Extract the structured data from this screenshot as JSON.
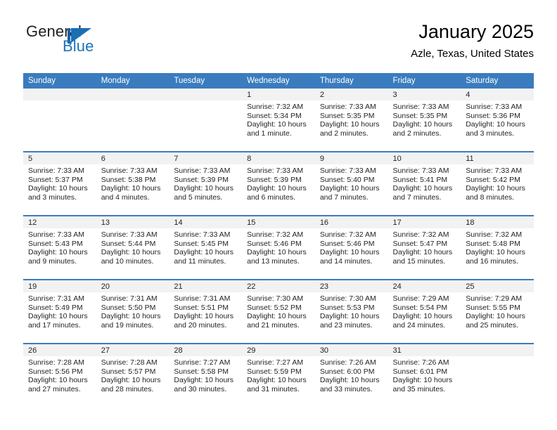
{
  "brand": {
    "name_top": "General",
    "name_bottom": "Blue",
    "mark": "triangle-flag-icon",
    "accent_color": "#1a75bc"
  },
  "header": {
    "month_title": "January 2025",
    "location": "Azle, Texas, United States"
  },
  "theme": {
    "header_row_bg": "#3a7cbe",
    "day_strip_bg": "#f2f2f2",
    "separator_color": "#3a7cbe",
    "text_color": "#231f20"
  },
  "weekday_headers": [
    "Sunday",
    "Monday",
    "Tuesday",
    "Wednesday",
    "Thursday",
    "Friday",
    "Saturday"
  ],
  "weeks": [
    [
      {
        "day": "",
        "sunrise": "",
        "sunset": "",
        "daylight_1": "",
        "daylight_2": ""
      },
      {
        "day": "",
        "sunrise": "",
        "sunset": "",
        "daylight_1": "",
        "daylight_2": ""
      },
      {
        "day": "",
        "sunrise": "",
        "sunset": "",
        "daylight_1": "",
        "daylight_2": ""
      },
      {
        "day": "1",
        "sunrise": "Sunrise: 7:32 AM",
        "sunset": "Sunset: 5:34 PM",
        "daylight_1": "Daylight: 10 hours",
        "daylight_2": "and 1 minute."
      },
      {
        "day": "2",
        "sunrise": "Sunrise: 7:33 AM",
        "sunset": "Sunset: 5:35 PM",
        "daylight_1": "Daylight: 10 hours",
        "daylight_2": "and 2 minutes."
      },
      {
        "day": "3",
        "sunrise": "Sunrise: 7:33 AM",
        "sunset": "Sunset: 5:35 PM",
        "daylight_1": "Daylight: 10 hours",
        "daylight_2": "and 2 minutes."
      },
      {
        "day": "4",
        "sunrise": "Sunrise: 7:33 AM",
        "sunset": "Sunset: 5:36 PM",
        "daylight_1": "Daylight: 10 hours",
        "daylight_2": "and 3 minutes."
      }
    ],
    [
      {
        "day": "5",
        "sunrise": "Sunrise: 7:33 AM",
        "sunset": "Sunset: 5:37 PM",
        "daylight_1": "Daylight: 10 hours",
        "daylight_2": "and 3 minutes."
      },
      {
        "day": "6",
        "sunrise": "Sunrise: 7:33 AM",
        "sunset": "Sunset: 5:38 PM",
        "daylight_1": "Daylight: 10 hours",
        "daylight_2": "and 4 minutes."
      },
      {
        "day": "7",
        "sunrise": "Sunrise: 7:33 AM",
        "sunset": "Sunset: 5:39 PM",
        "daylight_1": "Daylight: 10 hours",
        "daylight_2": "and 5 minutes."
      },
      {
        "day": "8",
        "sunrise": "Sunrise: 7:33 AM",
        "sunset": "Sunset: 5:39 PM",
        "daylight_1": "Daylight: 10 hours",
        "daylight_2": "and 6 minutes."
      },
      {
        "day": "9",
        "sunrise": "Sunrise: 7:33 AM",
        "sunset": "Sunset: 5:40 PM",
        "daylight_1": "Daylight: 10 hours",
        "daylight_2": "and 7 minutes."
      },
      {
        "day": "10",
        "sunrise": "Sunrise: 7:33 AM",
        "sunset": "Sunset: 5:41 PM",
        "daylight_1": "Daylight: 10 hours",
        "daylight_2": "and 7 minutes."
      },
      {
        "day": "11",
        "sunrise": "Sunrise: 7:33 AM",
        "sunset": "Sunset: 5:42 PM",
        "daylight_1": "Daylight: 10 hours",
        "daylight_2": "and 8 minutes."
      }
    ],
    [
      {
        "day": "12",
        "sunrise": "Sunrise: 7:33 AM",
        "sunset": "Sunset: 5:43 PM",
        "daylight_1": "Daylight: 10 hours",
        "daylight_2": "and 9 minutes."
      },
      {
        "day": "13",
        "sunrise": "Sunrise: 7:33 AM",
        "sunset": "Sunset: 5:44 PM",
        "daylight_1": "Daylight: 10 hours",
        "daylight_2": "and 10 minutes."
      },
      {
        "day": "14",
        "sunrise": "Sunrise: 7:33 AM",
        "sunset": "Sunset: 5:45 PM",
        "daylight_1": "Daylight: 10 hours",
        "daylight_2": "and 11 minutes."
      },
      {
        "day": "15",
        "sunrise": "Sunrise: 7:32 AM",
        "sunset": "Sunset: 5:46 PM",
        "daylight_1": "Daylight: 10 hours",
        "daylight_2": "and 13 minutes."
      },
      {
        "day": "16",
        "sunrise": "Sunrise: 7:32 AM",
        "sunset": "Sunset: 5:46 PM",
        "daylight_1": "Daylight: 10 hours",
        "daylight_2": "and 14 minutes."
      },
      {
        "day": "17",
        "sunrise": "Sunrise: 7:32 AM",
        "sunset": "Sunset: 5:47 PM",
        "daylight_1": "Daylight: 10 hours",
        "daylight_2": "and 15 minutes."
      },
      {
        "day": "18",
        "sunrise": "Sunrise: 7:32 AM",
        "sunset": "Sunset: 5:48 PM",
        "daylight_1": "Daylight: 10 hours",
        "daylight_2": "and 16 minutes."
      }
    ],
    [
      {
        "day": "19",
        "sunrise": "Sunrise: 7:31 AM",
        "sunset": "Sunset: 5:49 PM",
        "daylight_1": "Daylight: 10 hours",
        "daylight_2": "and 17 minutes."
      },
      {
        "day": "20",
        "sunrise": "Sunrise: 7:31 AM",
        "sunset": "Sunset: 5:50 PM",
        "daylight_1": "Daylight: 10 hours",
        "daylight_2": "and 19 minutes."
      },
      {
        "day": "21",
        "sunrise": "Sunrise: 7:31 AM",
        "sunset": "Sunset: 5:51 PM",
        "daylight_1": "Daylight: 10 hours",
        "daylight_2": "and 20 minutes."
      },
      {
        "day": "22",
        "sunrise": "Sunrise: 7:30 AM",
        "sunset": "Sunset: 5:52 PM",
        "daylight_1": "Daylight: 10 hours",
        "daylight_2": "and 21 minutes."
      },
      {
        "day": "23",
        "sunrise": "Sunrise: 7:30 AM",
        "sunset": "Sunset: 5:53 PM",
        "daylight_1": "Daylight: 10 hours",
        "daylight_2": "and 23 minutes."
      },
      {
        "day": "24",
        "sunrise": "Sunrise: 7:29 AM",
        "sunset": "Sunset: 5:54 PM",
        "daylight_1": "Daylight: 10 hours",
        "daylight_2": "and 24 minutes."
      },
      {
        "day": "25",
        "sunrise": "Sunrise: 7:29 AM",
        "sunset": "Sunset: 5:55 PM",
        "daylight_1": "Daylight: 10 hours",
        "daylight_2": "and 25 minutes."
      }
    ],
    [
      {
        "day": "26",
        "sunrise": "Sunrise: 7:28 AM",
        "sunset": "Sunset: 5:56 PM",
        "daylight_1": "Daylight: 10 hours",
        "daylight_2": "and 27 minutes."
      },
      {
        "day": "27",
        "sunrise": "Sunrise: 7:28 AM",
        "sunset": "Sunset: 5:57 PM",
        "daylight_1": "Daylight: 10 hours",
        "daylight_2": "and 28 minutes."
      },
      {
        "day": "28",
        "sunrise": "Sunrise: 7:27 AM",
        "sunset": "Sunset: 5:58 PM",
        "daylight_1": "Daylight: 10 hours",
        "daylight_2": "and 30 minutes."
      },
      {
        "day": "29",
        "sunrise": "Sunrise: 7:27 AM",
        "sunset": "Sunset: 5:59 PM",
        "daylight_1": "Daylight: 10 hours",
        "daylight_2": "and 31 minutes."
      },
      {
        "day": "30",
        "sunrise": "Sunrise: 7:26 AM",
        "sunset": "Sunset: 6:00 PM",
        "daylight_1": "Daylight: 10 hours",
        "daylight_2": "and 33 minutes."
      },
      {
        "day": "31",
        "sunrise": "Sunrise: 7:26 AM",
        "sunset": "Sunset: 6:01 PM",
        "daylight_1": "Daylight: 10 hours",
        "daylight_2": "and 35 minutes."
      },
      {
        "day": "",
        "sunrise": "",
        "sunset": "",
        "daylight_1": "",
        "daylight_2": ""
      }
    ]
  ]
}
